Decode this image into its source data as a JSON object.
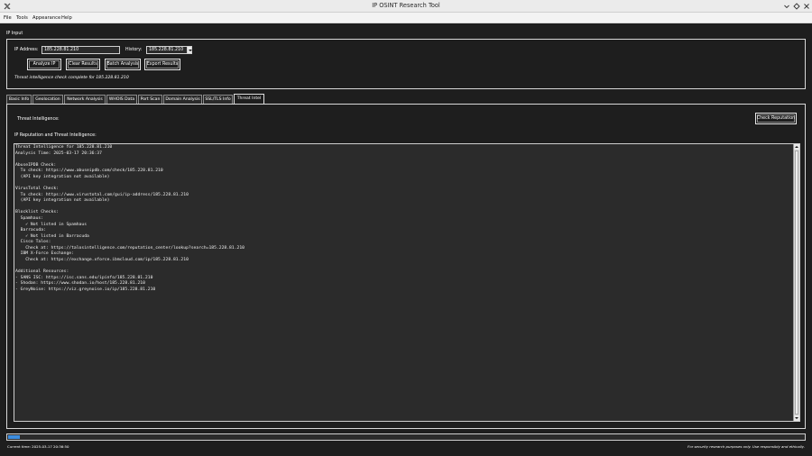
{
  "window": {
    "title": "IP OSINT Research Tool"
  },
  "menu": {
    "items": [
      "File",
      "Tools",
      "Appearance",
      "Help"
    ]
  },
  "ip_input": {
    "frame_label": "IP Input",
    "ip_label": "IP Address:",
    "ip_value": "185.228.81.210",
    "history_label": "History:",
    "history_value": "185.228.81.210",
    "buttons": {
      "analyze": "Analyze IP",
      "clear": "Clear Results",
      "batch": "Batch Analysis",
      "export": "Export Results"
    },
    "status_text": "Threat intelligence check complete for 185.228.81.210"
  },
  "tabs": [
    {
      "label": "Basic Info",
      "active": false
    },
    {
      "label": "Geolocation",
      "active": false
    },
    {
      "label": "Network Analysis",
      "active": false
    },
    {
      "label": "WHOIS Data",
      "active": false
    },
    {
      "label": "Port Scan",
      "active": false
    },
    {
      "label": "Domain Analysis",
      "active": false
    },
    {
      "label": "SSL/TLS Info",
      "active": false
    },
    {
      "label": "Threat Intel",
      "active": true
    }
  ],
  "threat_panel": {
    "heading": "Threat Intelligence:",
    "check_button": "Check Reputation",
    "section_label": "IP Reputation and Threat Intelligence:",
    "output_text": "Threat Intelligence for 185.228.81.210\nAnalysis Time: 2025-03-17 20:36:37\n\nAbuseIPDB Check:\n  To check: https://www.abuseipdb.com/check/185.228.81.210\n  (API key integration not available)\n\nVirusTotal Check:\n  To check: https://www.virustotal.com/gui/ip-address/185.228.81.210\n  (API key integration not available)\n\nBlocklist Checks:\n  Spamhaus:\n    ✓ Not listed in Spamhaus\n  Barracuda:\n    ✓ Not listed in Barracuda\n  Cisco Talos:\n    Check at: https://talosintelligence.com/reputation_center/lookup?search=185.228.81.210\n  IBM X-Force Exchange:\n    Check at: https://exchange.xforce.ibmcloud.com/ip/185.228.81.210\n\nAdditional Resources:\n- SANS ISC: https://isc.sans.edu/ipinfo/185.228.81.210\n- Shodan: https://www.shodan.io/host/185.228.81.210\n- GreyNoise: https://viz.greynoise.io/ip/185.228.81.210"
  },
  "progress": {
    "fraction": 0.015
  },
  "footer": {
    "current_time": "Current time: 2025-03-17 20:36:50",
    "disclaimer": "For security research purposes only. Use responsibly and ethically."
  },
  "colors": {
    "background": "#1e1e1e",
    "field_bg": "#2b2b2b",
    "progress_fill": "#3d8ee0",
    "titlebar": "#ebebeb"
  }
}
